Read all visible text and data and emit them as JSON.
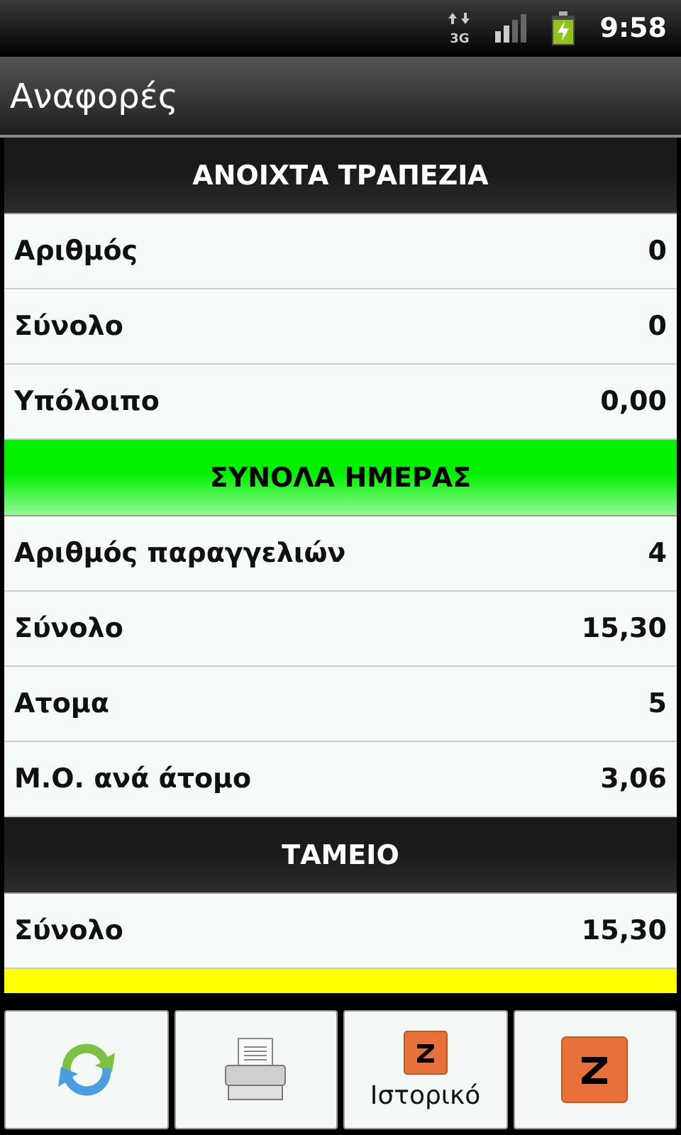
{
  "status_bar": {
    "network": "3G",
    "time": "9:58"
  },
  "title": "Αναφορές",
  "sections": [
    {
      "title": "ΑΝΟΙΧΤΑ ΤΡΑΠΕΖΙΑ",
      "color": "#1a1a1a",
      "rows": [
        {
          "label": "Αριθμός",
          "value": "0"
        },
        {
          "label": "Σύνολο",
          "value": "0"
        },
        {
          "label": "Υπόλοιπο",
          "value": "0,00"
        }
      ]
    },
    {
      "title": "ΣΥΝΟΛΑ ΗΜΕΡΑΣ",
      "color": "#00f000",
      "rows": [
        {
          "label": "Αριθμός παραγγελιών",
          "value": "4"
        },
        {
          "label": "Σύνολο",
          "value": "15,30"
        },
        {
          "label": "Ατομα",
          "value": "5"
        },
        {
          "label": "Μ.Ο. ανά άτομο",
          "value": "3,06"
        }
      ]
    },
    {
      "title": "ΤΑΜΕΙΟ",
      "color": "#1a1a1a",
      "rows": [
        {
          "label": "Σύνολο",
          "value": "15,30"
        }
      ]
    },
    {
      "color": "#ffff00"
    }
  ],
  "buttons": [
    {
      "kind": "refresh"
    },
    {
      "kind": "print"
    },
    {
      "kind": "z-small",
      "label": "Ιστορικό"
    },
    {
      "kind": "z-large"
    }
  ]
}
